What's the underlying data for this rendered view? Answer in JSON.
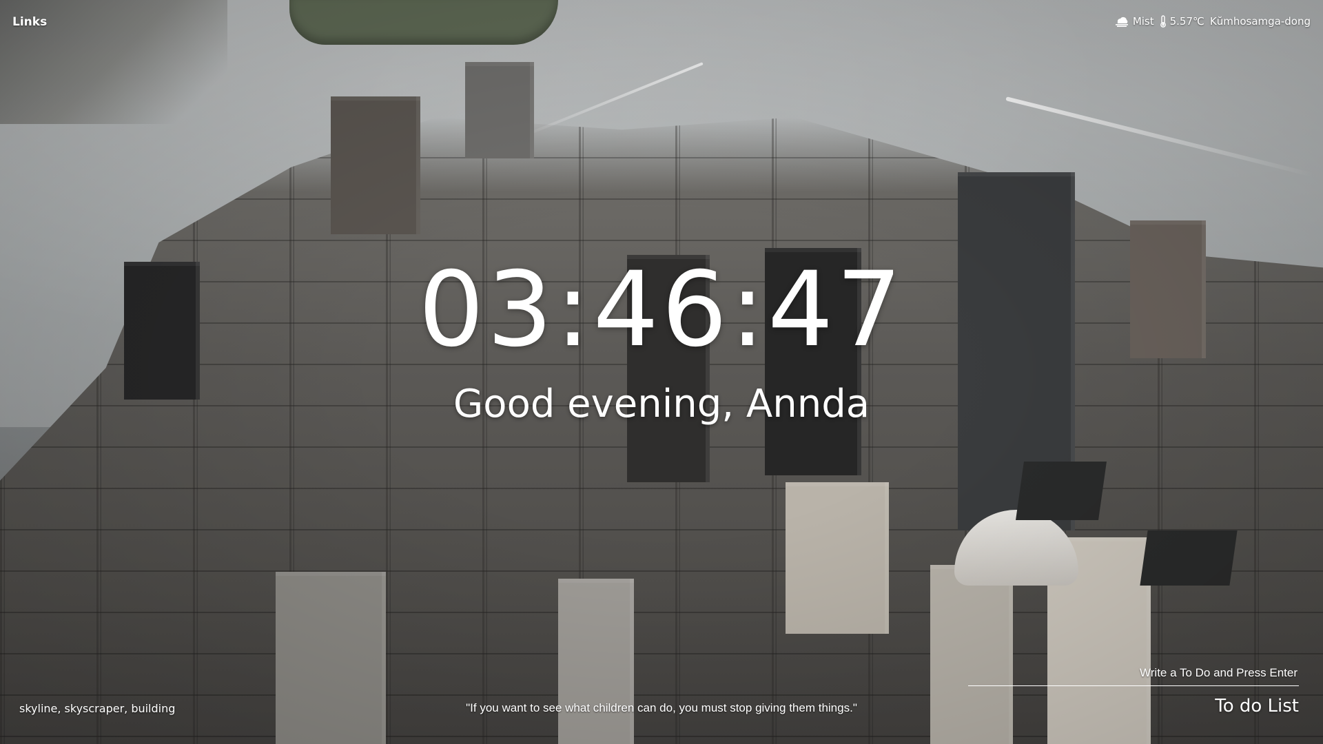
{
  "top_left": {
    "links_label": "Links"
  },
  "weather": {
    "condition": "Mist",
    "condition_icon": "cloud-mist-icon",
    "temperature": "5.57℃",
    "temperature_icon": "thermometer-icon",
    "location": "Kŭmhosamga-dong"
  },
  "clock": {
    "time": "03:46:47"
  },
  "greeting": {
    "text": "Good evening, Annda"
  },
  "photo": {
    "tags": "skyline, skyscraper, building"
  },
  "quote": {
    "text": "\"If you want to see what children can do, you must stop giving them things.\""
  },
  "todo": {
    "placeholder": "Write a To Do and Press Enter",
    "title": "To do List"
  },
  "colors": {
    "text": "#ffffff"
  }
}
